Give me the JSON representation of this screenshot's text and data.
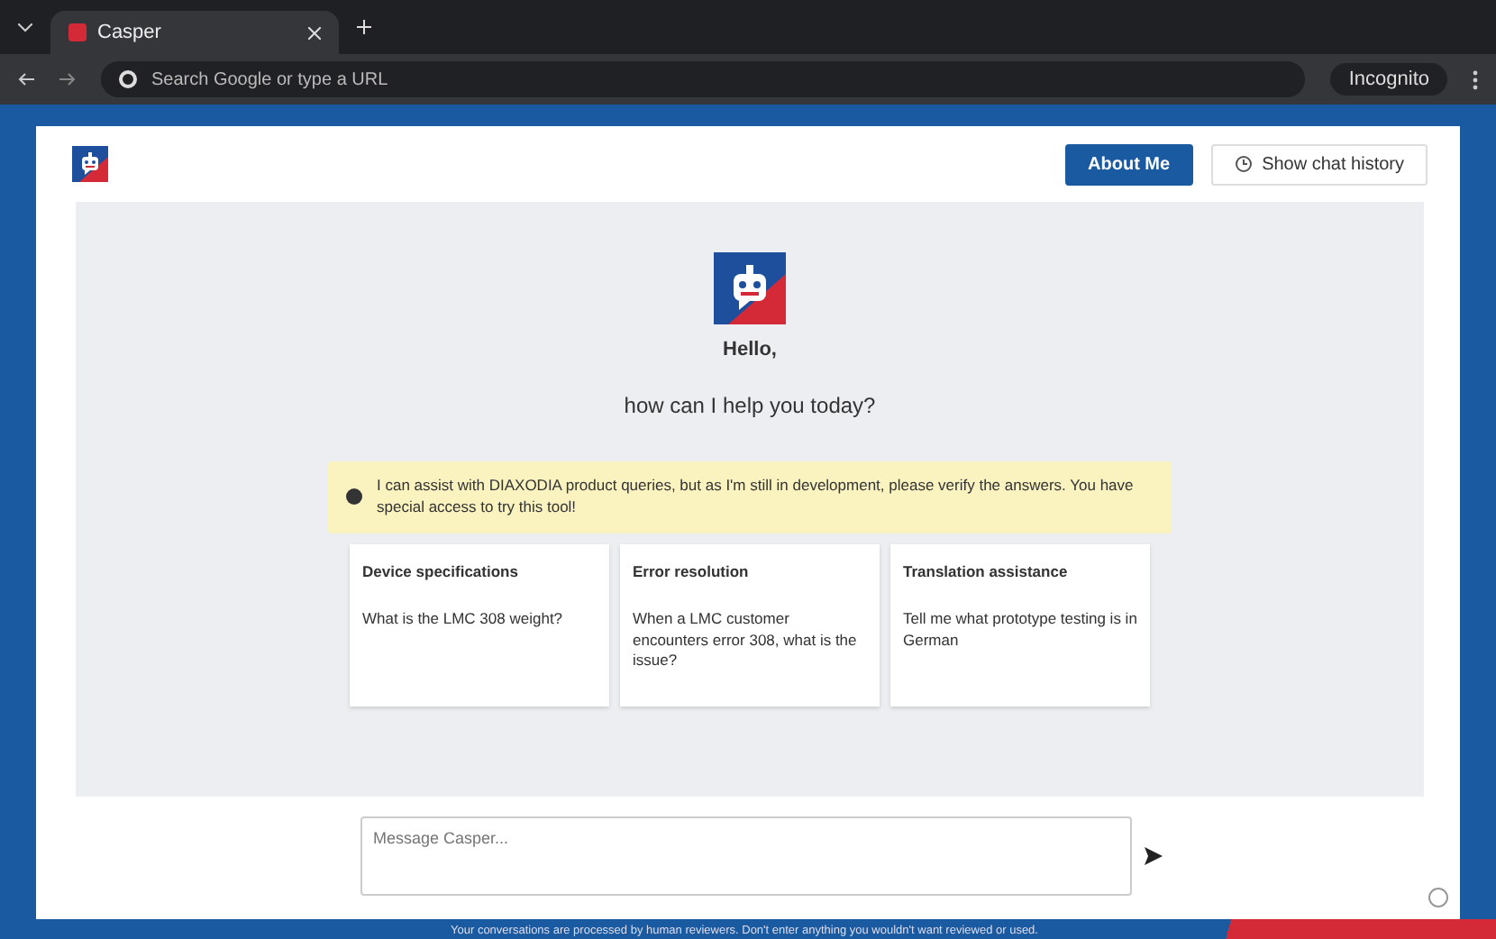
{
  "browser": {
    "tab_title": "Casper",
    "address_placeholder": "Search Google or type a URL",
    "profile": "Incognito"
  },
  "header": {
    "buttons": [
      {
        "label": "About Me",
        "kind": "primary"
      },
      {
        "label": "Show chat history",
        "kind": "history"
      }
    ]
  },
  "welcome": {
    "greeting": "Hello,",
    "question": "how can I help you today?"
  },
  "notice": "I can assist with DIAXODIA product queries, but as I'm still in development, please verify the answers. You have special access to try this tool!",
  "suggestions": [
    {
      "title": "Device specifications",
      "prompt": "What is the LMC 308 weight?"
    },
    {
      "title": "Error resolution",
      "prompt": "When a LMC customer encounters error 308, what is the issue?"
    },
    {
      "title": "Translation assistance",
      "prompt": "Tell me what prototype testing is in German"
    }
  ],
  "composer": {
    "placeholder": "Message Casper..."
  },
  "footer": "Your conversations are processed by human reviewers. Don't enter anything you wouldn't want reviewed or used."
}
